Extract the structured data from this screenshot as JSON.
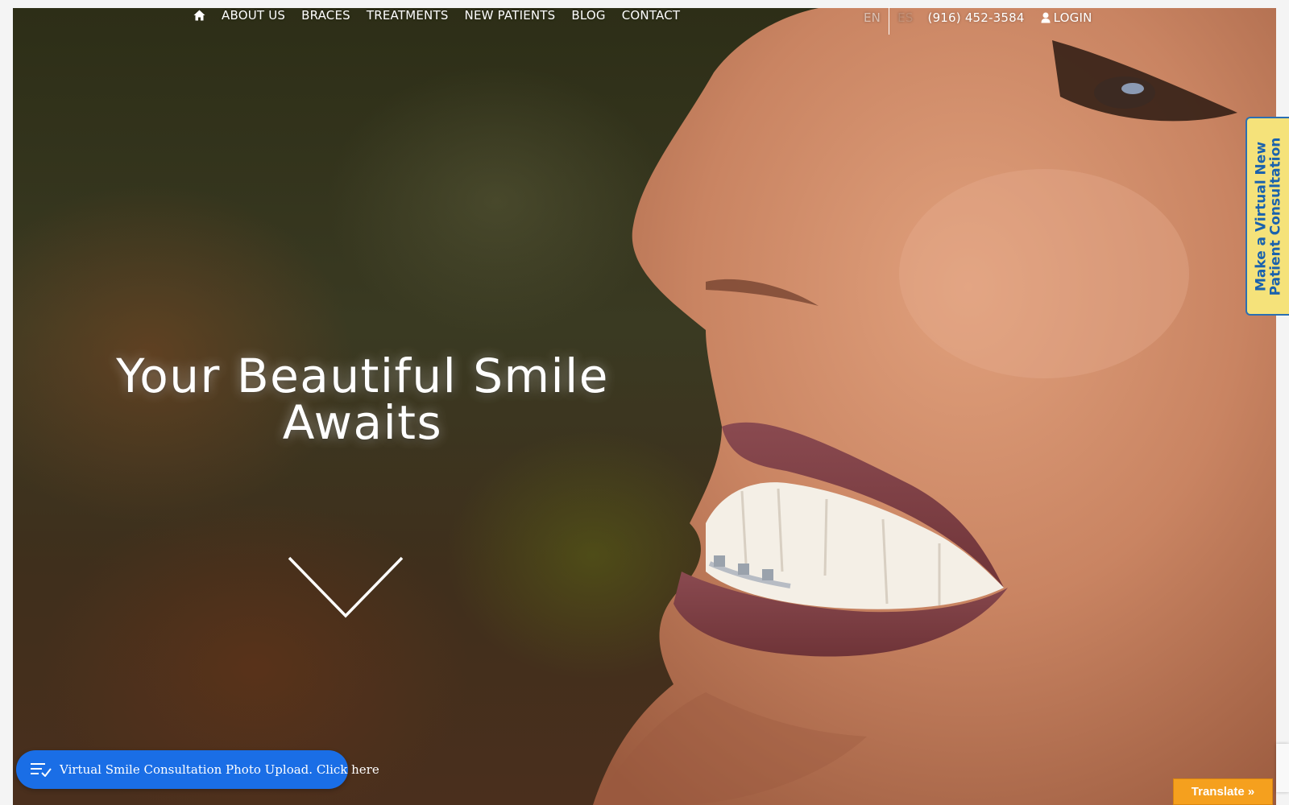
{
  "nav": {
    "items": [
      {
        "label": "ABOUT US"
      },
      {
        "label": "BRACES"
      },
      {
        "label": "TREATMENTS"
      },
      {
        "label": "NEW PATIENTS"
      },
      {
        "label": "BLOG"
      },
      {
        "label": "CONTACT"
      }
    ],
    "lang_en": "EN",
    "lang_es": "ES",
    "phone": "(916) 452-3584",
    "login": "LOGIN"
  },
  "hero": {
    "title_line1": "Your Beautiful Smile",
    "title_line2": "Awaits"
  },
  "side_tab": {
    "line1": "Make a Virtual New",
    "line2": "Patient Consultation"
  },
  "consult_widget": {
    "label": "Virtual Smile Consultation Photo Upload. Click here"
  },
  "translate": {
    "label": "Translate »"
  },
  "colors": {
    "side_tab_bg": "#f5e27a",
    "side_tab_text": "#1a62ad",
    "consult_pill_bg": "#1a6ee6",
    "translate_bg": "#f5a01e"
  },
  "icons": {
    "home": "home-icon",
    "login": "user-icon",
    "scroll": "chevron-down-icon",
    "consult": "checklist-icon"
  }
}
